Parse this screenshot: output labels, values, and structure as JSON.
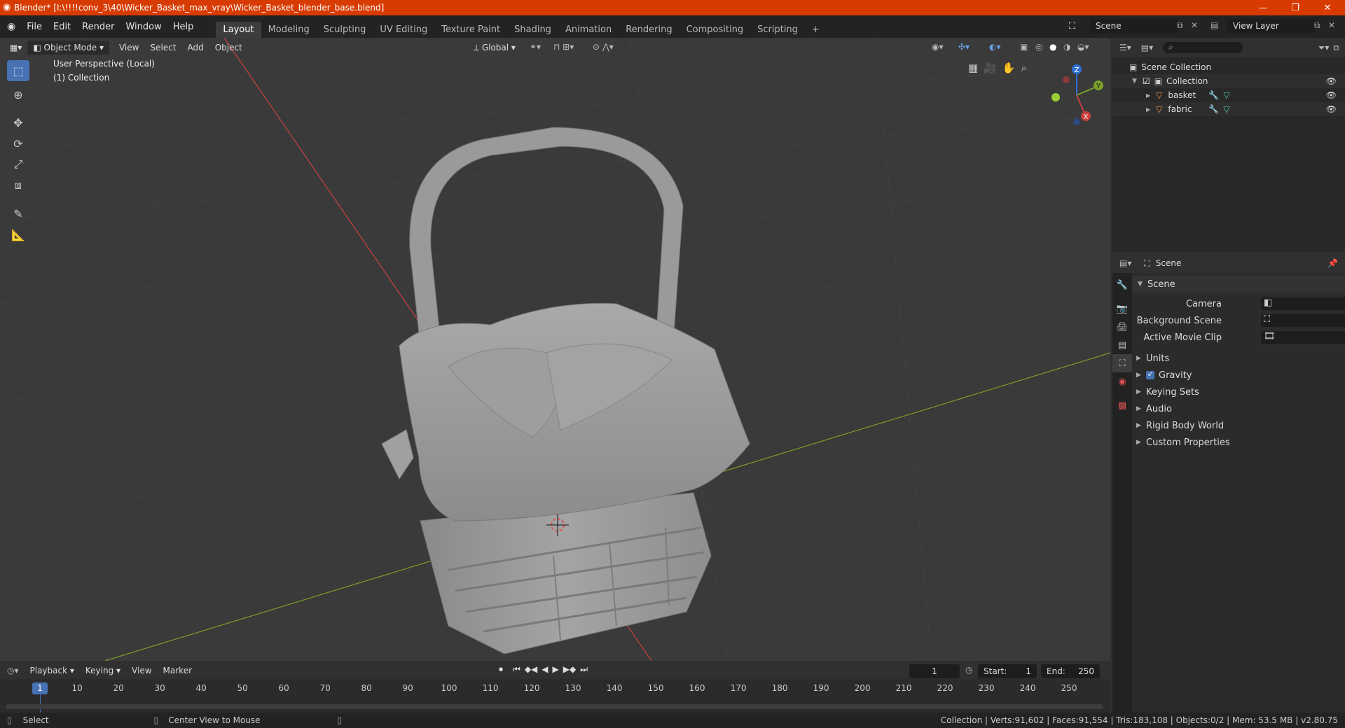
{
  "window": {
    "title": "Blender* [I:\\!!!!conv_3\\40\\Wicker_Basket_max_vray\\Wicker_Basket_blender_base.blend]",
    "minimize": "—",
    "maximize": "❐",
    "close": "✕"
  },
  "menu": {
    "file": "File",
    "edit": "Edit",
    "render": "Render",
    "window": "Window",
    "help": "Help"
  },
  "workspaces": [
    "Layout",
    "Modeling",
    "Sculpting",
    "UV Editing",
    "Texture Paint",
    "Shading",
    "Animation",
    "Rendering",
    "Compositing",
    "Scripting"
  ],
  "add_workspace": "+",
  "scene_field": "Scene",
  "view_layer_field": "View Layer",
  "viewport_header": {
    "mode": "Object Mode",
    "view": "View",
    "select": "Select",
    "add": "Add",
    "object": "Object",
    "orientation": "Global"
  },
  "viewport": {
    "perspective": "User Perspective (Local)",
    "collection": "(1) Collection",
    "gizmo": {
      "x": "X",
      "y": "Y",
      "z": "Z"
    }
  },
  "outliner": {
    "scene_collection": "Scene Collection",
    "collection": "Collection",
    "objects": [
      "basket",
      "fabric"
    ]
  },
  "properties": {
    "header": "Scene",
    "panel_title": "Scene",
    "camera_label": "Camera",
    "background_scene_label": "Background Scene",
    "active_movie_clip_label": "Active Movie Clip",
    "panels": [
      "Units",
      "Gravity",
      "Keying Sets",
      "Audio",
      "Rigid Body World",
      "Custom Properties"
    ]
  },
  "timeline": {
    "playback": "Playback",
    "keying": "Keying",
    "view": "View",
    "marker": "Marker",
    "current_frame": "1",
    "start_label": "Start:",
    "start_value": "1",
    "end_label": "End:",
    "end_value": "250",
    "cursor_frame": "1",
    "ticks": [
      "10",
      "20",
      "30",
      "40",
      "50",
      "60",
      "70",
      "80",
      "90",
      "100",
      "110",
      "120",
      "130",
      "140",
      "150",
      "160",
      "170",
      "180",
      "190",
      "200",
      "210",
      "220",
      "230",
      "240",
      "250"
    ]
  },
  "statusbar": {
    "select": "Select",
    "center_view": "Center View to Mouse",
    "stats": "Collection | Verts:91,602 | Faces:91,554 | Tris:183,108 | Objects:0/2 | Mem: 53.5 MB | v2.80.75"
  },
  "colors": {
    "titlebar": "#d83b01",
    "accent": "#4772b3",
    "x_axis": "#c8403f",
    "y_axis": "#7ba02a",
    "z_axis": "#2f6fd6"
  }
}
